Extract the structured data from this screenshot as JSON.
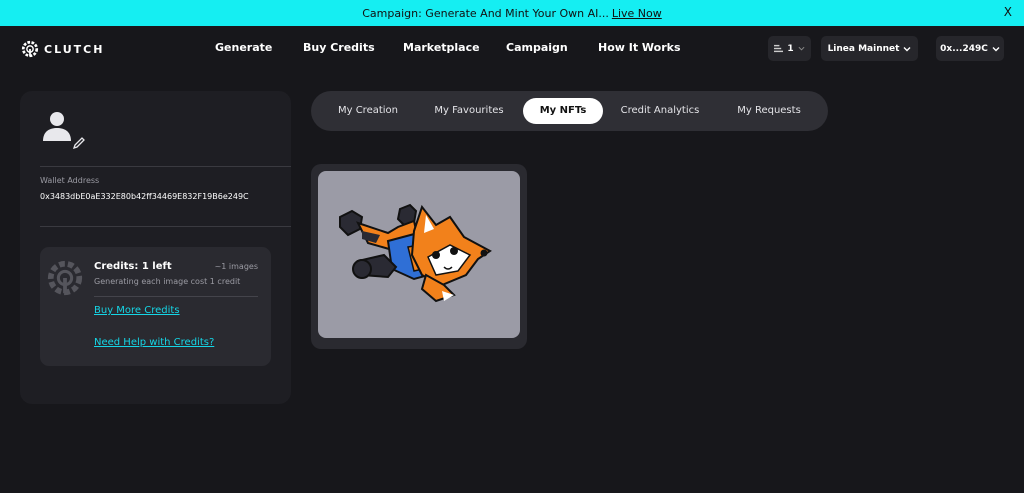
{
  "banner": {
    "text": "Campaign: Generate And Mint Your Own AI...",
    "link": "Live Now",
    "close": "X"
  },
  "header": {
    "logo_text": "CLUTCH",
    "nav": [
      "Generate",
      "Buy Credits",
      "Marketplace",
      "Campaign",
      "How It Works"
    ],
    "counter": "1",
    "network": "Linea Mainnet",
    "wallet": "0x...249C"
  },
  "profile": {
    "wallet_label": "Wallet Address",
    "wallet_address": "0x3483dbE0aE332E80b42ff34469E832F19B6e249C",
    "credits_title": "Credits: 1 left",
    "credits_images": "~1 images",
    "credits_note": "Generating each image cost 1 credit",
    "buy_link": "Buy More Credits",
    "help_link": "Need Help with Credits?"
  },
  "tabs": {
    "items": [
      "My Creation",
      "My Favourites",
      "My NFTs",
      "Credit Analytics",
      "My Requests"
    ],
    "active": "My NFTs"
  },
  "colors": {
    "accent": "#15eef2",
    "link": "#15d6e6",
    "background": "#17171b",
    "card": "#1e1e23"
  },
  "icons": [
    "clutch-logo-icon",
    "list-icon",
    "chevron-down-icon",
    "user-icon",
    "pencil-icon",
    "credits-logo-icon",
    "close-icon"
  ]
}
